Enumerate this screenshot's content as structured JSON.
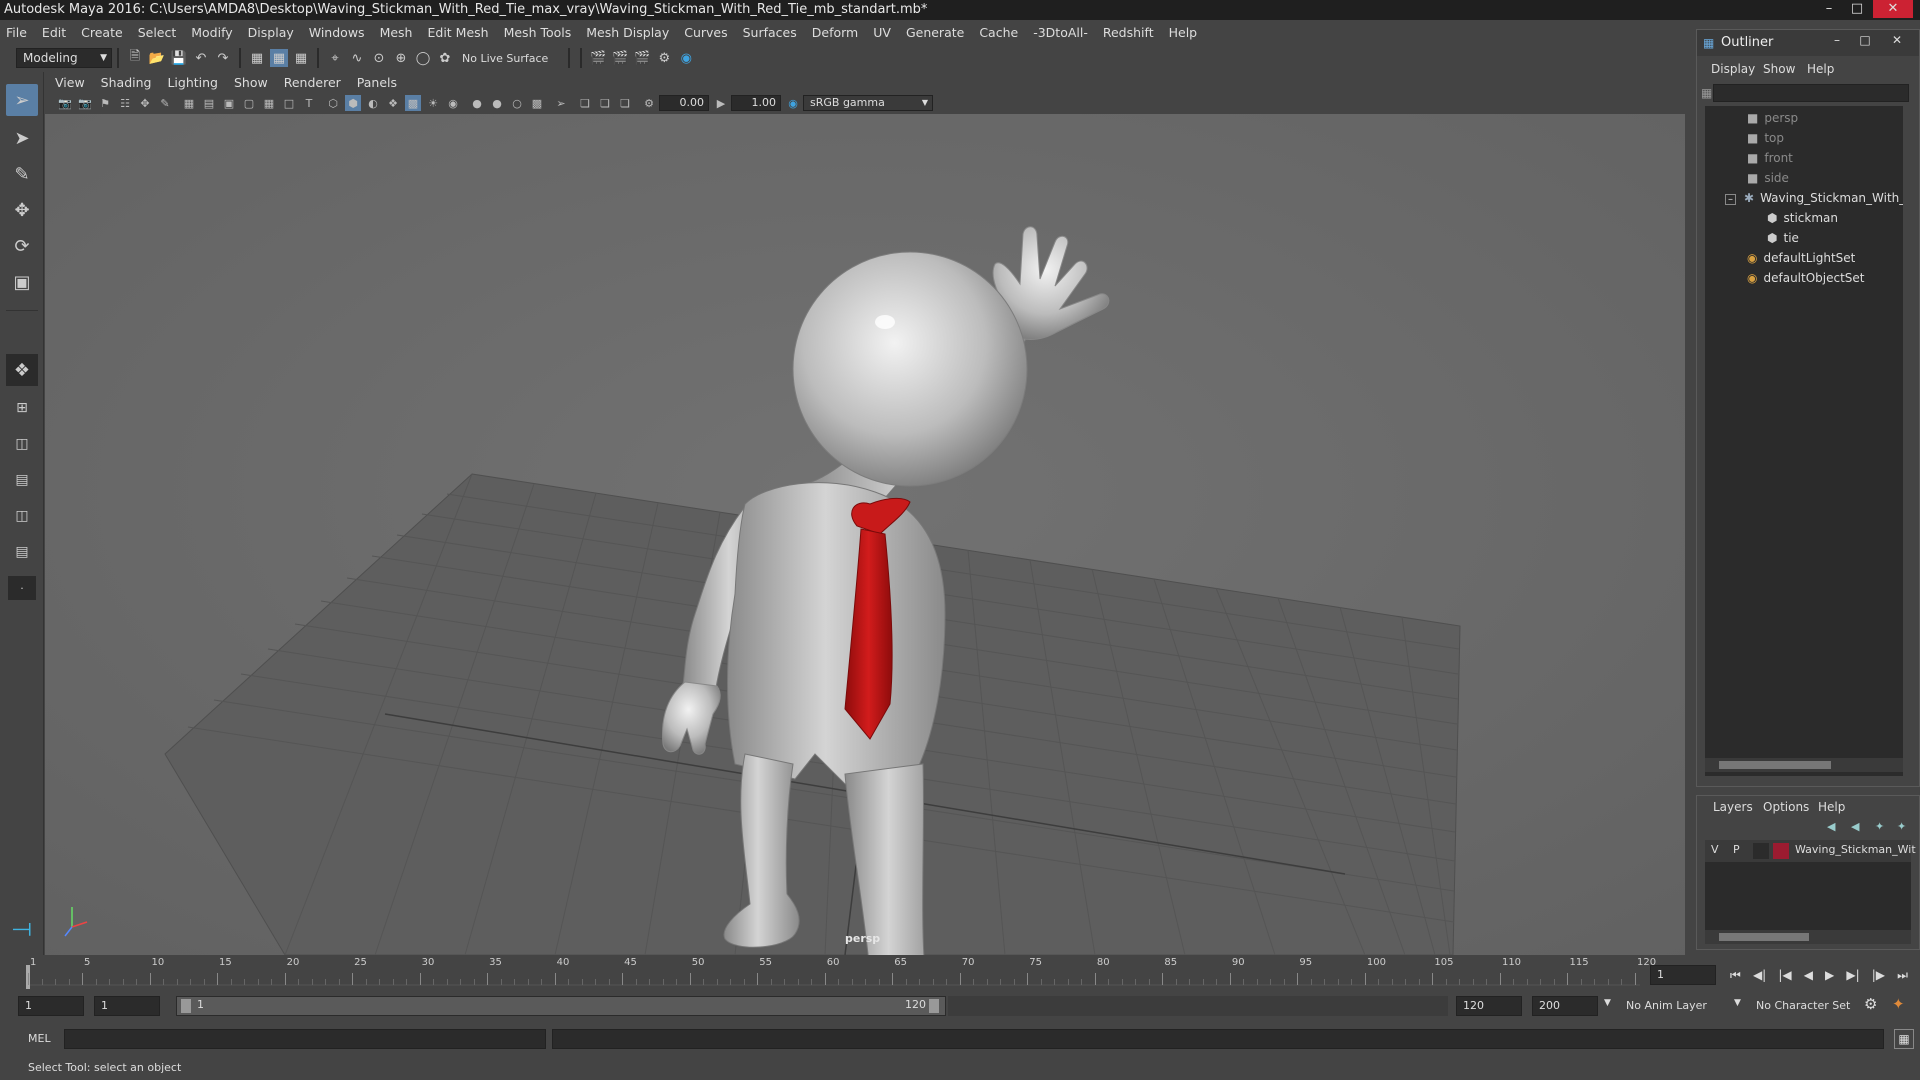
{
  "window": {
    "title": "Autodesk Maya 2016: C:\\Users\\AMDA8\\Desktop\\Waving_Stickman_With_Red_Tie_max_vray\\Waving_Stickman_With_Red_Tie_mb_standart.mb*"
  },
  "menu": [
    "File",
    "Edit",
    "Create",
    "Select",
    "Modify",
    "Display",
    "Windows",
    "Mesh",
    "Edit Mesh",
    "Mesh Tools",
    "Mesh Display",
    "Curves",
    "Surfaces",
    "Deform",
    "UV",
    "Generate",
    "Cache",
    "-3DtoAll-",
    "Redshift",
    "Help"
  ],
  "shelf": {
    "mode": "Modeling",
    "live_surface": "No Live Surface"
  },
  "panel": {
    "menu": [
      "View",
      "Shading",
      "Lighting",
      "Show",
      "Renderer",
      "Panels"
    ],
    "exposure": "0.00",
    "gamma": "1.00",
    "color_space": "sRGB gamma",
    "camera_label": "persp"
  },
  "outliner": {
    "title": "Outliner",
    "menu": [
      "Display",
      "Show",
      "Help"
    ],
    "items": [
      {
        "label": "persp",
        "icon": "camera-icon"
      },
      {
        "label": "top",
        "icon": "camera-icon"
      },
      {
        "label": "front",
        "icon": "camera-icon"
      },
      {
        "label": "side",
        "icon": "camera-icon"
      },
      {
        "label": "Waving_Stickman_With_R",
        "icon": "group-icon"
      },
      {
        "label": "stickman",
        "icon": "mesh-icon"
      },
      {
        "label": "tie",
        "icon": "mesh-icon"
      },
      {
        "label": "defaultLightSet",
        "icon": "set-icon"
      },
      {
        "label": "defaultObjectSet",
        "icon": "set-icon"
      }
    ]
  },
  "layers": {
    "menu": [
      "Layers",
      "Options",
      "Help"
    ],
    "row": {
      "v": "V",
      "p": "P",
      "name": "Waving_Stickman_Wit",
      "color": "#9b1b30"
    }
  },
  "timeline": {
    "ticks": [
      "1",
      "5",
      "10",
      "15",
      "20",
      "25",
      "30",
      "35",
      "40",
      "45",
      "50",
      "55",
      "60",
      "65",
      "70",
      "75",
      "80",
      "85",
      "90",
      "95",
      "100",
      "105",
      "110",
      "115",
      "120"
    ],
    "current_frame": "1"
  },
  "range": {
    "start": "1",
    "anim_start": "1",
    "slider_start": "1",
    "slider_end": "120",
    "end": "120",
    "anim_end": "200",
    "anim_layer": "No Anim Layer",
    "character_set": "No Character Set"
  },
  "command": {
    "label": "MEL"
  },
  "help_line": "Select Tool: select an object"
}
